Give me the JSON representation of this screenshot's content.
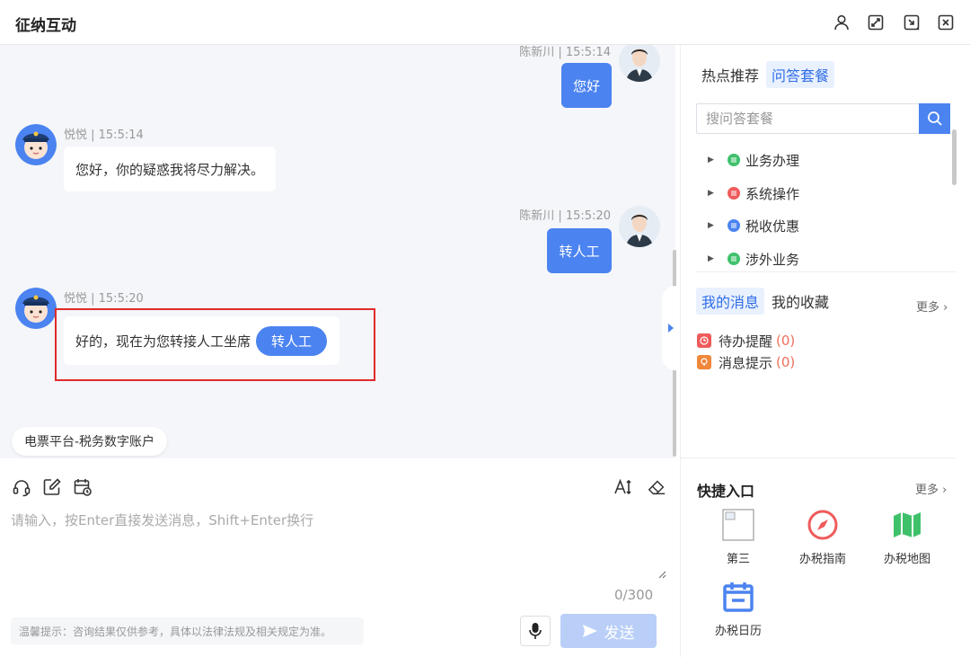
{
  "window": {
    "title": "征纳互动",
    "controls": [
      "user-icon",
      "maximize-icon",
      "minimize-icon",
      "close-icon"
    ]
  },
  "chat": {
    "messages": [
      {
        "role": "user",
        "meta": "陈新川 | 15:5:14",
        "text": "您好"
      },
      {
        "role": "bot",
        "meta": "悦悦 | 15:5:14",
        "text": "您好，你的疑惑我将尽力解决。"
      },
      {
        "role": "user",
        "meta": "陈新川 | 15:5:20",
        "text": "转人工"
      },
      {
        "role": "bot",
        "meta": "悦悦 | 15:5:20",
        "text": "好的，现在为您转接人工坐席",
        "button": "转人工"
      }
    ],
    "source_chip": "电票平台-税务数字账户"
  },
  "composer": {
    "placeholder": "请输入，按Enter直接发送消息，Shift+Enter换行",
    "counter": "0/300",
    "tip": "温馨提示：咨询结果仅供参考，具体以法律法规及相关规定为准。",
    "send_label": "发送"
  },
  "sidebar": {
    "tabs": [
      {
        "label": "热点推荐",
        "active": false
      },
      {
        "label": "问答套餐",
        "active": true
      }
    ],
    "search_placeholder": "搜问答套餐",
    "tree": [
      {
        "label": "业务办理",
        "color": "#3fc16b"
      },
      {
        "label": "系统操作",
        "color": "#ef5b5b"
      },
      {
        "label": "税收优惠",
        "color": "#4b83f0"
      },
      {
        "label": "涉外业务",
        "color": "#3fc16b"
      }
    ],
    "msg_tabs": [
      {
        "label": "我的消息",
        "active": true
      },
      {
        "label": "我的收藏",
        "active": false
      }
    ],
    "more": "更多",
    "notices": [
      {
        "label": "待办提醒",
        "count": "(0)",
        "color": "#ef5b5b"
      },
      {
        "label": "消息提示",
        "count": "(0)",
        "color": "#f0873a"
      }
    ],
    "quick_title": "快捷入口",
    "quick_more": "更多",
    "quick": [
      {
        "label": "第三",
        "icon": "broken-image-icon"
      },
      {
        "label": "办税指南",
        "icon": "compass-icon",
        "color": "#ef5b5b"
      },
      {
        "label": "办税地图",
        "icon": "map-icon",
        "color": "#3fc16b"
      },
      {
        "label": "办税日历",
        "icon": "calendar-icon",
        "color": "#4b83f0"
      }
    ]
  }
}
